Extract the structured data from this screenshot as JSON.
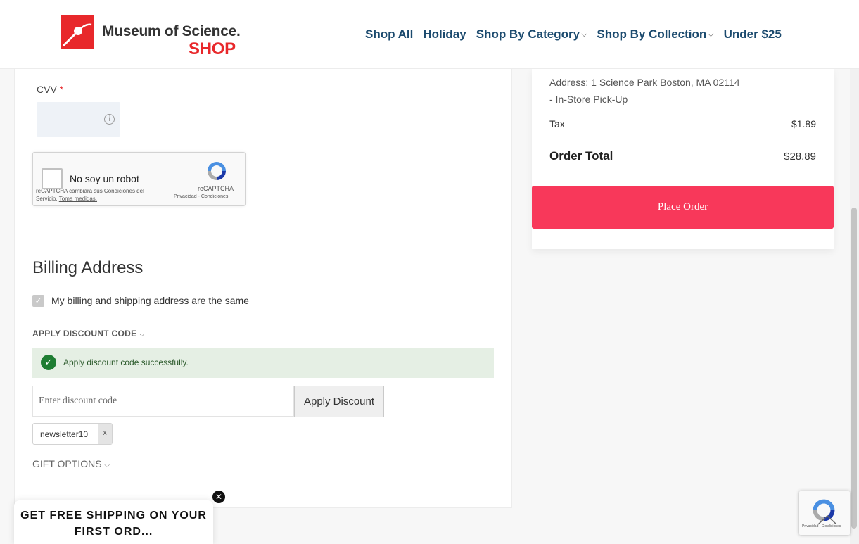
{
  "header": {
    "logo_line1": "Museum of Science.",
    "logo_line2": "SHOP",
    "nav": [
      {
        "label": "Shop All"
      },
      {
        "label": "Holiday"
      },
      {
        "label": "Shop By Category"
      },
      {
        "label": "Shop By Collection"
      },
      {
        "label": "Under $25"
      }
    ],
    "brand_color": "#e8282b",
    "nav_color": "#1b4a6e"
  },
  "payment": {
    "cvv_label": "CVV",
    "required_mark": "*"
  },
  "recaptcha": {
    "label": "No soy un robot",
    "terms": "reCAPTCHA cambiará sus Condiciones del Servicio.",
    "terms_link": "Toma medidas.",
    "brand": "reCAPTCHA",
    "links": "Privacidad - Condiciones"
  },
  "billing": {
    "title": "Billing Address",
    "same_address_label": "My billing and shipping address are the same",
    "same_address_checked": true
  },
  "discount": {
    "toggle_label": "APPLY DISCOUNT CODE",
    "success_message": "Apply discount code successfully.",
    "input_placeholder": "Enter discount code",
    "apply_label": "Apply Discount",
    "applied_code": "newsletter10",
    "remove_label": "x"
  },
  "gift": {
    "toggle_label": "GIFT OPTIONS"
  },
  "summary": {
    "address_line1": "Address: 1 Science Park Boston, MA 02114",
    "address_line2": "- In-Store Pick-Up",
    "tax_label": "Tax",
    "tax_value": "$1.89",
    "total_label": "Order Total",
    "total_value": "$28.89",
    "place_order_label": "Place Order",
    "place_order_color": "#f8385a"
  },
  "promo": {
    "text_line1": "GET FREE SHIPPING ON YOUR",
    "text_line2": "FIRST ORD...",
    "close_label": "✕"
  },
  "rc_badge": {
    "text": "Privacidad - Condiciones"
  },
  "icons": [
    "info-icon",
    "checkmark-icon",
    "chevron-down-icon",
    "close-icon",
    "recaptcha-logo-icon",
    "back-to-top-icon"
  ]
}
